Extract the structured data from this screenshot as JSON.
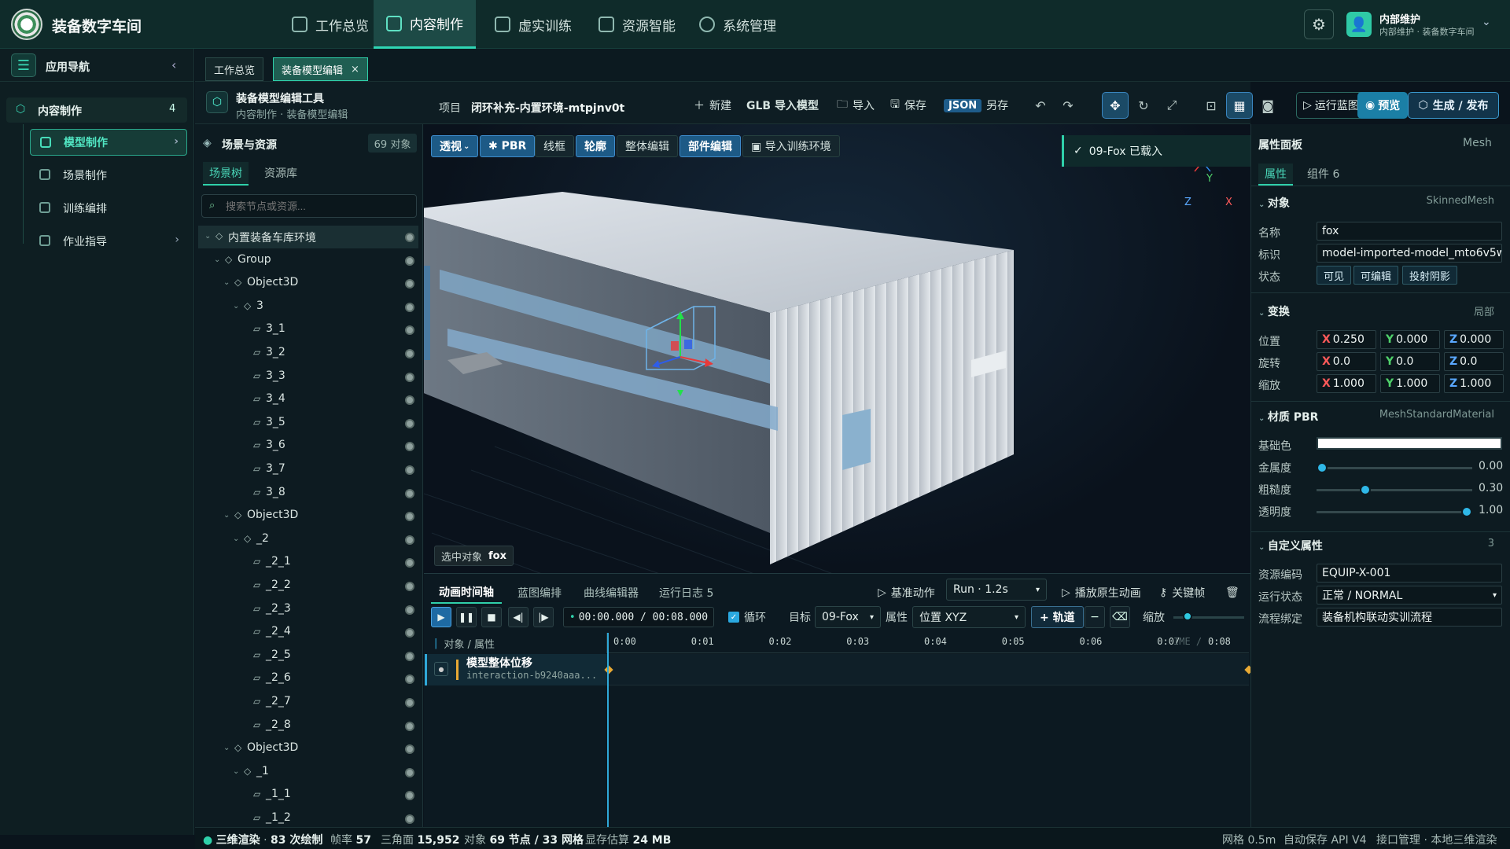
{
  "app": {
    "title": "装备数字车间"
  },
  "topnav": [
    {
      "label": "工作总览",
      "active": false
    },
    {
      "label": "内容制作",
      "active": true
    },
    {
      "label": "虚实训练",
      "active": false
    },
    {
      "label": "资源智能",
      "active": false
    },
    {
      "label": "系统管理",
      "active": false
    }
  ],
  "user": {
    "name": "内部维护",
    "role": "内部维护 · 装备数字车间"
  },
  "sidenav": {
    "title": "应用导航",
    "section": {
      "label": "内容制作",
      "count": "4"
    },
    "items": [
      {
        "label": "模型制作",
        "active": true
      },
      {
        "label": "场景制作"
      },
      {
        "label": "训练编排"
      },
      {
        "label": "作业指导"
      }
    ]
  },
  "tabs": [
    {
      "label": "工作总览"
    },
    {
      "label": "装备模型编辑",
      "active": true
    }
  ],
  "tool": {
    "title": "装备模型编辑工具",
    "crumb": "内容制作 · 装备模型编辑",
    "project_label": "项目",
    "project_name": "闭环补充-内置环境-mtpjnv0t",
    "new_label": "新建",
    "glb_label": "GLB 导入模型",
    "import_label": "导入",
    "save_label": "保存",
    "json_chip": "JSON",
    "saveas_label": "另存",
    "run_blueprint": "运行蓝图",
    "preview": "预览",
    "publish": "生成 / 发布"
  },
  "scene_panel": {
    "title": "场景与资源",
    "count": "69 对象",
    "tabs": [
      "场景树",
      "资源库"
    ],
    "search_placeholder": "搜索节点或资源...",
    "tree": [
      {
        "label": "内置装备车库环境",
        "depth": 0,
        "type": "group",
        "expanded": true
      },
      {
        "label": "Group",
        "depth": 1,
        "type": "group",
        "expanded": true
      },
      {
        "label": "Object3D",
        "depth": 2,
        "type": "group",
        "expanded": true
      },
      {
        "label": "3",
        "depth": 3,
        "type": "group",
        "expanded": true
      },
      {
        "label": "3_1",
        "depth": 4,
        "type": "mesh"
      },
      {
        "label": "3_2",
        "depth": 4,
        "type": "mesh"
      },
      {
        "label": "3_3",
        "depth": 4,
        "type": "mesh"
      },
      {
        "label": "3_4",
        "depth": 4,
        "type": "mesh"
      },
      {
        "label": "3_5",
        "depth": 4,
        "type": "mesh"
      },
      {
        "label": "3_6",
        "depth": 4,
        "type": "mesh"
      },
      {
        "label": "3_7",
        "depth": 4,
        "type": "mesh"
      },
      {
        "label": "3_8",
        "depth": 4,
        "type": "mesh"
      },
      {
        "label": "Object3D",
        "depth": 2,
        "type": "group",
        "expanded": true
      },
      {
        "label": "_2",
        "depth": 3,
        "type": "group",
        "expanded": true
      },
      {
        "label": "_2_1",
        "depth": 4,
        "type": "mesh"
      },
      {
        "label": "_2_2",
        "depth": 4,
        "type": "mesh"
      },
      {
        "label": "_2_3",
        "depth": 4,
        "type": "mesh"
      },
      {
        "label": "_2_4",
        "depth": 4,
        "type": "mesh"
      },
      {
        "label": "_2_5",
        "depth": 4,
        "type": "mesh"
      },
      {
        "label": "_2_6",
        "depth": 4,
        "type": "mesh"
      },
      {
        "label": "_2_7",
        "depth": 4,
        "type": "mesh"
      },
      {
        "label": "_2_8",
        "depth": 4,
        "type": "mesh"
      },
      {
        "label": "Object3D",
        "depth": 2,
        "type": "group",
        "expanded": true
      },
      {
        "label": "_1",
        "depth": 3,
        "type": "group",
        "expanded": true
      },
      {
        "label": "_1_1",
        "depth": 4,
        "type": "mesh"
      },
      {
        "label": "_1_2",
        "depth": 4,
        "type": "mesh"
      }
    ]
  },
  "viewport": {
    "toolbar": [
      {
        "label": "透视",
        "on": true
      },
      {
        "label": "✱ PBR",
        "on": true
      },
      {
        "label": "线框",
        "on": false
      },
      {
        "label": "轮廓",
        "on": true
      },
      {
        "label": "整体编辑",
        "on": false
      },
      {
        "label": "部件编辑",
        "on": true
      },
      {
        "label": "▣ 导入训练环境",
        "on": false
      }
    ],
    "notice": "09-Fox 已载入",
    "selected_label": "选中对象",
    "selected_value": "fox",
    "axes": {
      "x": "X",
      "y": "Y",
      "z": "Z"
    }
  },
  "timeline": {
    "tabs": [
      "动画时间轴",
      "蓝图编排",
      "曲线编辑器",
      "运行日志 5"
    ],
    "base_action": "基准动作",
    "run_select": "Run · 1.2s",
    "play_original": "播放原生动画",
    "keyframe": "关键帧",
    "time": "00:00.000 / 00:08.000",
    "loop": "循环",
    "target_label": "目标",
    "target_value": "09-Fox",
    "prop_label": "属性",
    "prop_value": "位置 XYZ",
    "add_track": "+ 轨道",
    "zoom_label": "缩放",
    "zoom_level": 0.15,
    "ruler_header": "对象 / 属性",
    "ticks": [
      "0:00",
      "0:01",
      "0:02",
      "0:03",
      "0:04",
      "0:05",
      "0:06",
      "0:07",
      "0:08"
    ],
    "ime_hint": "IME /",
    "track": {
      "title": "模型整体位移",
      "id": "interaction-b9240aaa..."
    }
  },
  "props": {
    "title": "属性面板",
    "mesh": "Mesh",
    "tabs": [
      "属性",
      "组件 6"
    ],
    "object": {
      "title": "对象",
      "type": "SkinnedMesh",
      "name_label": "名称",
      "name": "fox",
      "id_label": "标识",
      "id": "model-imported-model_mto6v5w",
      "state_label": "状态",
      "states": [
        "可见",
        "可编辑",
        "投射阴影"
      ]
    },
    "transform": {
      "title": "变换",
      "space": "局部",
      "rows": [
        {
          "label": "位置",
          "x": "0.250",
          "y": "0.000",
          "z": "0.000"
        },
        {
          "label": "旋转",
          "x": "0.0",
          "y": "0.0",
          "z": "0.0"
        },
        {
          "label": "缩放",
          "x": "1.000",
          "y": "1.000",
          "z": "1.000"
        }
      ]
    },
    "material": {
      "title": "材质 PBR",
      "type": "MeshStandardMaterial",
      "base_label": "基础色",
      "base_color": "#ffffff",
      "sliders": [
        {
          "label": "金属度",
          "value": "0.00",
          "level": 0.0
        },
        {
          "label": "粗糙度",
          "value": "0.30",
          "level": 0.3
        },
        {
          "label": "透明度",
          "value": "1.00",
          "level": 1.0
        }
      ]
    },
    "custom": {
      "title": "自定义属性",
      "count": "3",
      "rows": [
        {
          "label": "资源编码",
          "value": "EQUIP-X-001"
        },
        {
          "label": "运行状态",
          "value": "正常 / NORMAL"
        },
        {
          "label": "流程绑定",
          "value": "装备机构联动实训流程"
        }
      ]
    }
  },
  "status": {
    "render": "三维渲染",
    "draws": "83 次绘制",
    "fps_label": "帧率",
    "fps": "57",
    "tri_label": "三角面",
    "tri": "15,952",
    "obj_label": "对象",
    "obj": "69 节点 / 33 网格",
    "mem_label": "显存估算",
    "mem": "24 MB",
    "grid": "网格 0.5m",
    "autosave": "自动保存 API V4",
    "iface": "接口管理 · 本地三维渲染"
  },
  "colors": {
    "accent": "#2fd0aa",
    "primary": "#1b7fa6",
    "keyframe": "#e8a934"
  }
}
